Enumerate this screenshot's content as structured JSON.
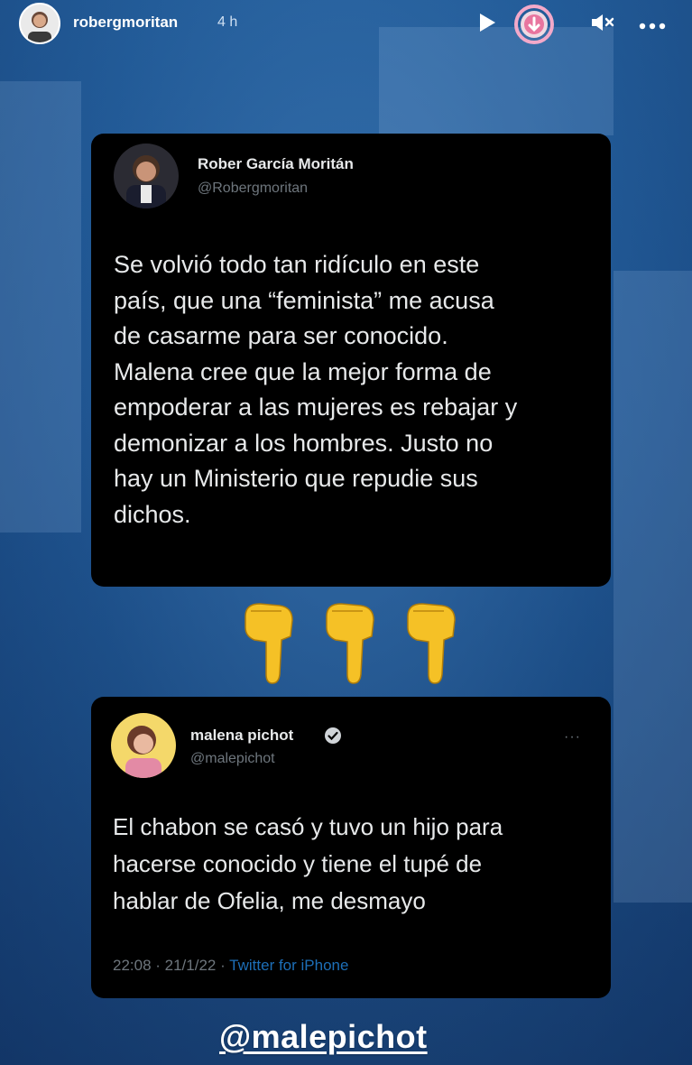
{
  "story": {
    "username": "robergmoritan",
    "time": "4 h",
    "icons": [
      "play-icon",
      "download-icon",
      "mute-icon",
      "more-icon"
    ]
  },
  "tweet1": {
    "name": "Rober García Moritán",
    "handle": "@Robergmoritan",
    "text": "Se volvió todo tan ridículo en este país, que una “feminista” me acusa de casarme para ser conocido. Malena cree que la mejor forma de empoderar a las mujeres es rebajar y demonizar a los hombres. Justo no hay un Ministerio que repudie sus dichos.",
    "lines": [
      "Se volvió todo tan ridículo en este",
      "país, que una “feminista” me acusa",
      "de casarme para ser conocido.",
      "Malena cree que la mejor forma de",
      "empoderar a las mujeres es rebajar y",
      "demonizar a los hombres. Justo no",
      "hay un Ministerio que repudie sus",
      "dichos."
    ]
  },
  "emoji": {
    "pointing_down": "👇👇👇"
  },
  "tweet2": {
    "name": "malena pichot",
    "handle": "@malepichot",
    "more": "···",
    "lines": [
      "El chabon se casó y tuvo un hijo para",
      "hacerse conocido y tiene el tupé de",
      "hablar de Ofelia, me desmayo"
    ],
    "timestamp": "22:08 · 21/1/22 · ",
    "source": "Twitter for iPhone"
  },
  "mention": "@malepichot",
  "colors": {
    "background": "#1d4f86",
    "card": "#000000",
    "tweet_text": "#e7e9ea",
    "muted": "#6e767d",
    "link": "#1d6fb8"
  }
}
